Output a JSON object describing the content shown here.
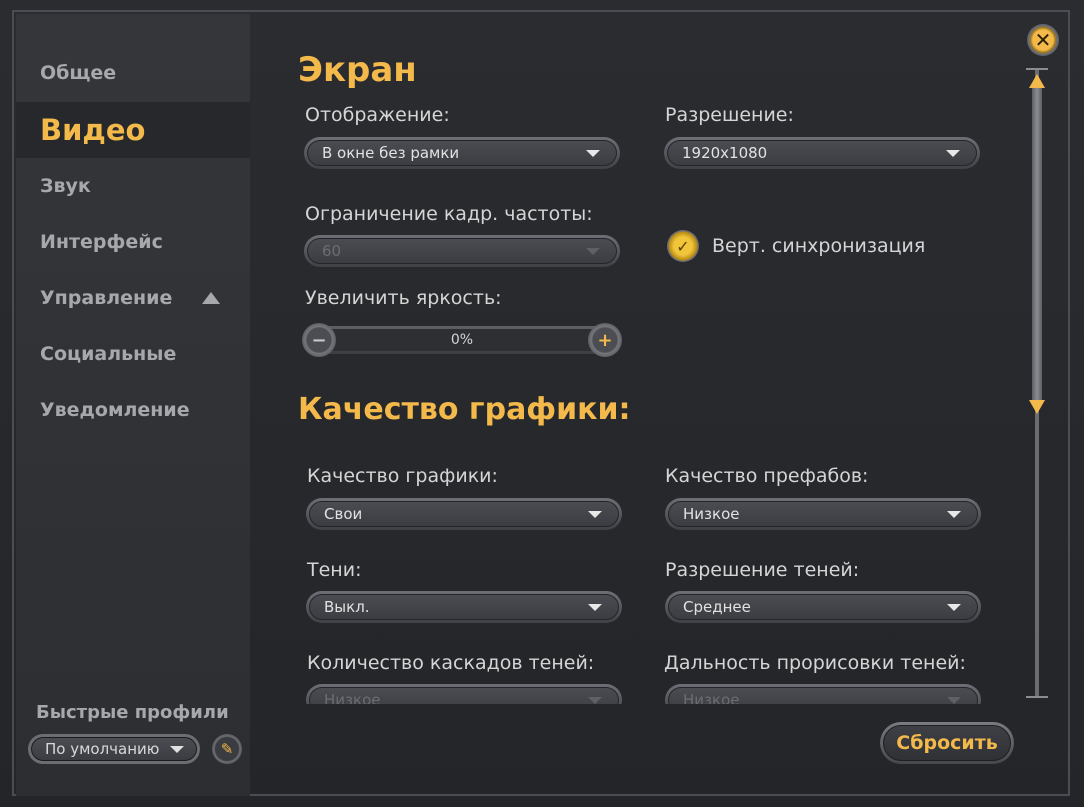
{
  "sidebar": {
    "items": [
      {
        "label": "Общее"
      },
      {
        "label": "Видео"
      },
      {
        "label": "Звук"
      },
      {
        "label": "Интерфейс"
      },
      {
        "label": "Управление"
      },
      {
        "label": "Социальные"
      },
      {
        "label": "Уведомление"
      }
    ],
    "active_index": 1,
    "quick_profiles": {
      "title": "Быстрые профили",
      "selected": "По умолчанию"
    }
  },
  "screen": {
    "title": "Экран",
    "display": {
      "label": "Отображение:",
      "value": "В окне без рамки"
    },
    "resolution": {
      "label": "Разрешение:",
      "value": "1920x1080"
    },
    "fps_limit": {
      "label": "Ограничение кадр. частоты:",
      "value": "60",
      "disabled": true
    },
    "vsync": {
      "label": "Верт. синхронизация",
      "checked": true
    },
    "brightness": {
      "label": "Увеличить яркость:",
      "value": "0%"
    }
  },
  "graphics": {
    "title": "Качество графики:",
    "quality": {
      "label": "Качество графики:",
      "value": "Свои"
    },
    "prefab_quality": {
      "label": "Качество префабов:",
      "value": "Низкое"
    },
    "shadows": {
      "label": "Тени:",
      "value": "Выкл."
    },
    "shadow_resolution": {
      "label": "Разрешение теней:",
      "value": "Среднее"
    },
    "shadow_cascades": {
      "label": "Количество каскадов теней:",
      "value": "Низкое"
    },
    "shadow_distance": {
      "label": "Дальность прорисовки теней:",
      "value": "Низкое"
    }
  },
  "buttons": {
    "reset": "Сбросить"
  },
  "colors": {
    "accent": "#f3b94a",
    "background": "#26282c",
    "text": "#d5d5d5"
  }
}
